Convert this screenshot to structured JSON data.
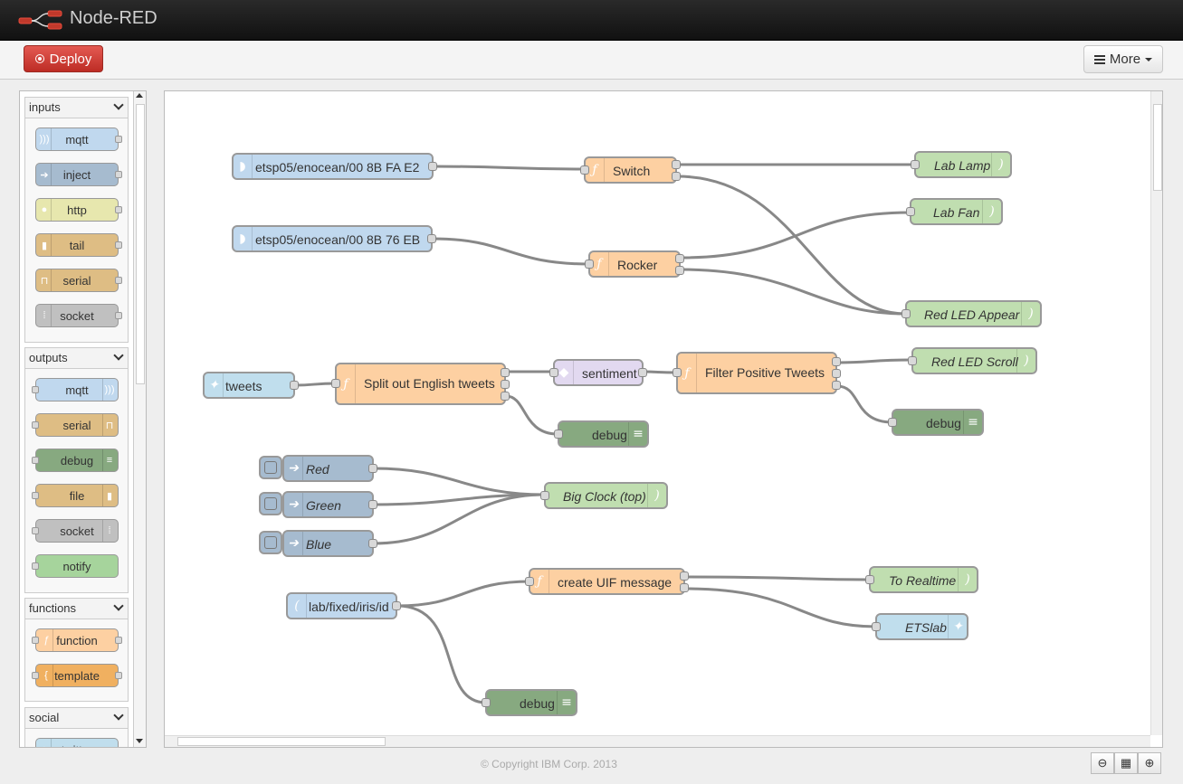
{
  "app": {
    "title": "Node-RED"
  },
  "toolbar": {
    "deploy_label": "Deploy",
    "more_label": "More"
  },
  "palette": {
    "categories": [
      {
        "name": "inputs",
        "nodes": [
          "mqtt",
          "inject",
          "http",
          "tail",
          "serial",
          "socket"
        ]
      },
      {
        "name": "outputs",
        "nodes": [
          "mqtt",
          "serial",
          "debug",
          "file",
          "socket",
          "notify"
        ]
      },
      {
        "name": "functions",
        "nodes": [
          "function",
          "template"
        ]
      },
      {
        "name": "social",
        "nodes": [
          "twitter"
        ]
      }
    ]
  },
  "flow": {
    "nodes": [
      {
        "id": "n1",
        "label": "etsp05/enocean/00 8B FA E2",
        "type": "mqtt-in"
      },
      {
        "id": "n2",
        "label": "Switch",
        "type": "function"
      },
      {
        "id": "n3",
        "label": "Lab Lamp",
        "type": "mqtt-out"
      },
      {
        "id": "n4",
        "label": "etsp05/enocean/00 8B 76 EB",
        "type": "mqtt-in"
      },
      {
        "id": "n5",
        "label": "Rocker",
        "type": "function"
      },
      {
        "id": "n6",
        "label": "Lab Fan",
        "type": "mqtt-out"
      },
      {
        "id": "n7",
        "label": "Red LED Appear",
        "type": "mqtt-out"
      },
      {
        "id": "n8",
        "label": "tweets",
        "type": "twitter-in"
      },
      {
        "id": "n9",
        "label": "Split out English tweets",
        "type": "function"
      },
      {
        "id": "n10",
        "label": "sentiment",
        "type": "sentiment"
      },
      {
        "id": "n11",
        "label": "Filter Positive Tweets",
        "type": "function"
      },
      {
        "id": "n12",
        "label": "Red LED Scroll",
        "type": "mqtt-out"
      },
      {
        "id": "n13",
        "label": "debug",
        "type": "debug"
      },
      {
        "id": "n14",
        "label": "debug",
        "type": "debug"
      },
      {
        "id": "n15",
        "label": "Red",
        "type": "inject"
      },
      {
        "id": "n16",
        "label": "Green",
        "type": "inject"
      },
      {
        "id": "n17",
        "label": "Blue",
        "type": "inject"
      },
      {
        "id": "n18",
        "label": "Big Clock (top)",
        "type": "mqtt-out"
      },
      {
        "id": "n19",
        "label": "lab/fixed/iris/id",
        "type": "mqtt-in"
      },
      {
        "id": "n20",
        "label": "create UIF message",
        "type": "function"
      },
      {
        "id": "n21",
        "label": "To Realtime",
        "type": "mqtt-out"
      },
      {
        "id": "n22",
        "label": "ETSlab",
        "type": "twitter-out"
      },
      {
        "id": "n23",
        "label": "debug",
        "type": "debug"
      }
    ]
  },
  "footer": {
    "copyright": "© Copyright IBM Corp. 2013"
  },
  "icons": [
    "node-red-logo-icon",
    "deploy-icon",
    "menu-icon",
    "zoom-out-icon",
    "zoom-reset-icon",
    "zoom-in-icon"
  ],
  "colors": {
    "deploy": "#d03a32",
    "mqtt": "#c0d8ee",
    "inject": "#a6bbcf",
    "http": "#e7e7ae",
    "file": "#debd84",
    "socket": "#c0c0c0",
    "function": "#fdd0a2",
    "template": "#f0b060",
    "debug": "#87a980",
    "notify": "#a6d49c",
    "output": "#c0deb0",
    "sentiment": "#e2d9f0",
    "twitter": "#c0deed",
    "wire": "#888888"
  }
}
